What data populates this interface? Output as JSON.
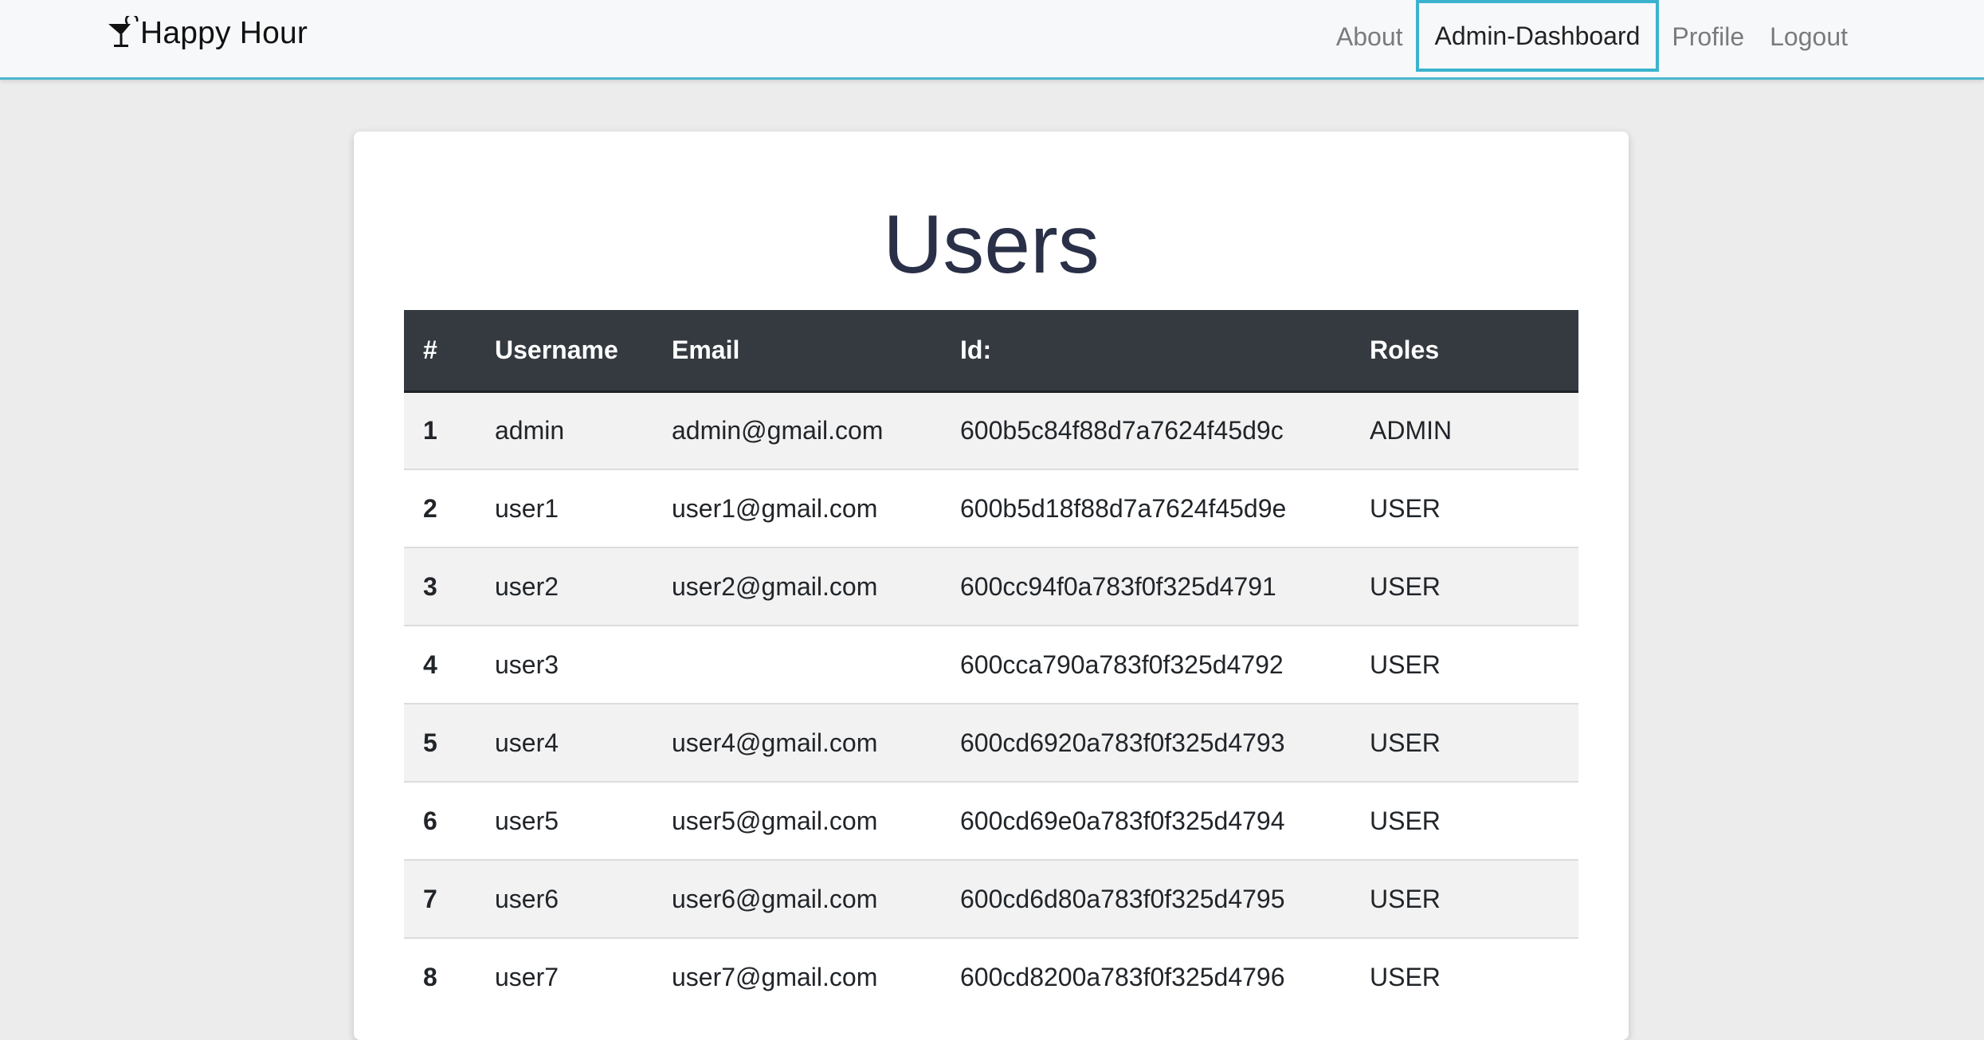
{
  "brand": {
    "name": "Happy Hour",
    "icon": "cocktail-glass-icon"
  },
  "nav": {
    "items": [
      {
        "label": "About",
        "active": false
      },
      {
        "label": "Admin-Dashboard",
        "active": true
      },
      {
        "label": "Profile",
        "active": false
      },
      {
        "label": "Logout",
        "active": false
      }
    ]
  },
  "page": {
    "title": "Users"
  },
  "table": {
    "headers": [
      "#",
      "Username",
      "Email",
      "Id:",
      "Roles"
    ],
    "rows": [
      {
        "num": "1",
        "username": "admin",
        "email": "admin@gmail.com",
        "id": "600b5c84f88d7a7624f45d9c",
        "roles": "ADMIN"
      },
      {
        "num": "2",
        "username": "user1",
        "email": "user1@gmail.com",
        "id": "600b5d18f88d7a7624f45d9e",
        "roles": "USER"
      },
      {
        "num": "3",
        "username": "user2",
        "email": "user2@gmail.com",
        "id": "600cc94f0a783f0f325d4791",
        "roles": "USER"
      },
      {
        "num": "4",
        "username": "user3",
        "email": "",
        "id": "600cca790a783f0f325d4792",
        "roles": "USER"
      },
      {
        "num": "5",
        "username": "user4",
        "email": "user4@gmail.com",
        "id": "600cd6920a783f0f325d4793",
        "roles": "USER"
      },
      {
        "num": "6",
        "username": "user5",
        "email": "user5@gmail.com",
        "id": "600cd69e0a783f0f325d4794",
        "roles": "USER"
      },
      {
        "num": "7",
        "username": "user6",
        "email": "user6@gmail.com",
        "id": "600cd6d80a783f0f325d4795",
        "roles": "USER"
      },
      {
        "num": "8",
        "username": "user7",
        "email": "user7@gmail.com",
        "id": "600cd8200a783f0f325d4796",
        "roles": "USER"
      }
    ]
  },
  "colors": {
    "nav_accent": "#3bb3cf",
    "table_header_bg": "#343a40",
    "title_color": "#2a3047"
  }
}
